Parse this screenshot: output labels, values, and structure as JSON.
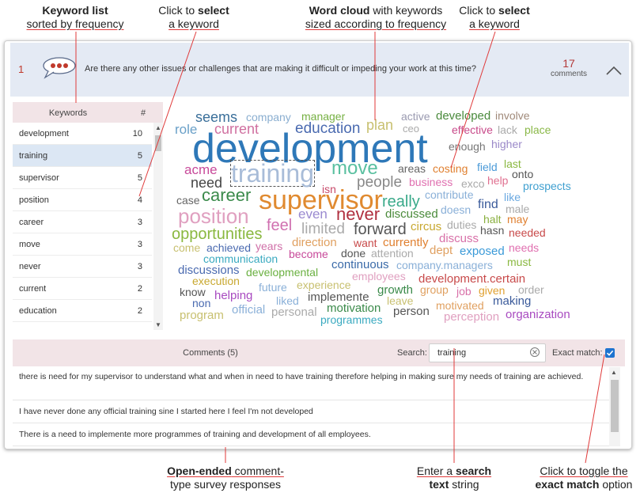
{
  "callouts": {
    "keyword_list": {
      "bold": "Keyword list",
      "rest": "sorted by frequency"
    },
    "click_select_1": {
      "pre": "Click to ",
      "bold": "select",
      "line2": "a keyword"
    },
    "word_cloud": {
      "bold": "Word cloud",
      "rest1": " with keywords",
      "line2": "sized according to frequency"
    },
    "click_select_2": {
      "pre": "Click to ",
      "bold": "select",
      "line2": "a keyword"
    },
    "open_ended": {
      "bold": "Open-ended",
      "rest1": " comment-",
      "line2": "type survey responses"
    },
    "search": {
      "pre": "Enter a ",
      "bold1": "search",
      "bold2": "text",
      "post": " string"
    },
    "toggle": {
      "line1": "Click to toggle the",
      "bold": "exact match",
      "post": " option"
    }
  },
  "question": {
    "number": "1",
    "text": "Are there any other issues or challenges that are making it difficult or impeding your work at this time?",
    "comment_count": "17",
    "comment_label": "comments",
    "icon": "speech-bubble-icon"
  },
  "keywords": {
    "header_label": "Keywords",
    "header_count": "#",
    "items": [
      {
        "word": "development",
        "count": "10"
      },
      {
        "word": "training",
        "count": "5"
      },
      {
        "word": "supervisor",
        "count": "5"
      },
      {
        "word": "position",
        "count": "4"
      },
      {
        "word": "career",
        "count": "3"
      },
      {
        "word": "move",
        "count": "3"
      },
      {
        "word": "never",
        "count": "3"
      },
      {
        "word": "current",
        "count": "2"
      },
      {
        "word": "education",
        "count": "2"
      }
    ]
  },
  "cloud": {
    "words": [
      {
        "t": "seems",
        "c": "#3a6f9a"
      },
      {
        "t": "company",
        "c": "#8aaed0"
      },
      {
        "t": "manager",
        "c": "#76b043"
      },
      {
        "t": "active",
        "c": "#9a9ab0"
      },
      {
        "t": "developed",
        "c": "#4a8a3c"
      },
      {
        "t": "involve",
        "c": "#a08a7a"
      },
      {
        "t": "role",
        "c": "#6aa0c8"
      },
      {
        "t": "current",
        "c": "#d070a0"
      },
      {
        "t": "education",
        "c": "#4a6ab0"
      },
      {
        "t": "plan",
        "c": "#c8c070"
      },
      {
        "t": "ceo",
        "c": "#aaaaaa"
      },
      {
        "t": "effective",
        "c": "#c84a8a"
      },
      {
        "t": "lack",
        "c": "#aaaaaa"
      },
      {
        "t": "place",
        "c": "#8ab848"
      },
      {
        "t": "development",
        "c": "#2e78b8"
      },
      {
        "t": "enough",
        "c": "#777777"
      },
      {
        "t": "higher",
        "c": "#9a88c8"
      },
      {
        "t": "acme",
        "c": "#c84a9a"
      },
      {
        "t": "training",
        "c": "#a8bcd8"
      },
      {
        "t": "move",
        "c": "#5ac0a0"
      },
      {
        "t": "areas",
        "c": "#666666"
      },
      {
        "t": "costing",
        "c": "#e08030"
      },
      {
        "t": "field",
        "c": "#4a9ad8"
      },
      {
        "t": "last",
        "c": "#8ab840"
      },
      {
        "t": "onto",
        "c": "#555555"
      },
      {
        "t": "need",
        "c": "#444444"
      },
      {
        "t": "people",
        "c": "#888888"
      },
      {
        "t": "business",
        "c": "#e070b0"
      },
      {
        "t": "exco",
        "c": "#aaaaaa"
      },
      {
        "t": "help",
        "c": "#e07090"
      },
      {
        "t": "prospects",
        "c": "#40a0d0"
      },
      {
        "t": "career",
        "c": "#3a8a4a"
      },
      {
        "t": "supervisor",
        "c": "#e08a30"
      },
      {
        "t": "isn",
        "c": "#c84a6a"
      },
      {
        "t": "contribute",
        "c": "#8ab0d8"
      },
      {
        "t": "like",
        "c": "#6aa8e0"
      },
      {
        "t": "case",
        "c": "#666666"
      },
      {
        "t": "really",
        "c": "#3aaa8a"
      },
      {
        "t": "find",
        "c": "#3a5a9a"
      },
      {
        "t": "male",
        "c": "#aaaaaa"
      },
      {
        "t": "position",
        "c": "#e0a0c0"
      },
      {
        "t": "even",
        "c": "#9a8ad0"
      },
      {
        "t": "never",
        "c": "#b03040"
      },
      {
        "t": "discussed",
        "c": "#4a8a3a"
      },
      {
        "t": "doesn",
        "c": "#8ab0d8"
      },
      {
        "t": "halt",
        "c": "#8ab040"
      },
      {
        "t": "may",
        "c": "#e08030"
      },
      {
        "t": "feel",
        "c": "#d070b0"
      },
      {
        "t": "limited",
        "c": "#aaaaaa"
      },
      {
        "t": "forward",
        "c": "#555555"
      },
      {
        "t": "circus",
        "c": "#c8a830"
      },
      {
        "t": "duties",
        "c": "#aaaaaa"
      },
      {
        "t": "hasn",
        "c": "#555555"
      },
      {
        "t": "needed",
        "c": "#c84a4a"
      },
      {
        "t": "opportunities",
        "c": "#8ab840"
      },
      {
        "t": "direction",
        "c": "#e0a060"
      },
      {
        "t": "want",
        "c": "#c84a4a"
      },
      {
        "t": "currently",
        "c": "#e08030"
      },
      {
        "t": "discuss",
        "c": "#d870a8"
      },
      {
        "t": "come",
        "c": "#c8c070"
      },
      {
        "t": "years",
        "c": "#d070a8"
      },
      {
        "t": "achieved",
        "c": "#4a6ab0"
      },
      {
        "t": "dept",
        "c": "#e0a060"
      },
      {
        "t": "exposed",
        "c": "#3a9ad8"
      },
      {
        "t": "needs",
        "c": "#e070b0"
      },
      {
        "t": "become",
        "c": "#c84a9a"
      },
      {
        "t": "done",
        "c": "#555555"
      },
      {
        "t": "attention",
        "c": "#aaaaaa"
      },
      {
        "t": "communication",
        "c": "#3aaac0"
      },
      {
        "t": "continuous",
        "c": "#3a6aa8"
      },
      {
        "t": "company.managers",
        "c": "#8ab0d8"
      },
      {
        "t": "must",
        "c": "#8ab840"
      },
      {
        "t": "discussions",
        "c": "#4a6ab0"
      },
      {
        "t": "developmental",
        "c": "#6ab040"
      },
      {
        "t": "employees",
        "c": "#e0a0c0"
      },
      {
        "t": "development.certain",
        "c": "#c84a4a"
      },
      {
        "t": "execution",
        "c": "#c8a830"
      },
      {
        "t": "future",
        "c": "#8ab0d8"
      },
      {
        "t": "experience",
        "c": "#c8c070"
      },
      {
        "t": "growth",
        "c": "#3a8a4a"
      },
      {
        "t": "group",
        "c": "#e0a060"
      },
      {
        "t": "job",
        "c": "#d870a8"
      },
      {
        "t": "order",
        "c": "#aaaaaa"
      },
      {
        "t": "know",
        "c": "#555555"
      },
      {
        "t": "helping",
        "c": "#a84ac0"
      },
      {
        "t": "implemente",
        "c": "#555555"
      },
      {
        "t": "leave",
        "c": "#c8c070"
      },
      {
        "t": "given",
        "c": "#e0a030"
      },
      {
        "t": "making",
        "c": "#3a5a9a"
      },
      {
        "t": "non",
        "c": "#4a6ab0"
      },
      {
        "t": "liked",
        "c": "#8ab0d8"
      },
      {
        "t": "motivated",
        "c": "#e0a060"
      },
      {
        "t": "official",
        "c": "#8ab0d8"
      },
      {
        "t": "personal",
        "c": "#aaaaaa"
      },
      {
        "t": "motivation",
        "c": "#3a8a4a"
      },
      {
        "t": "person",
        "c": "#555555"
      },
      {
        "t": "program",
        "c": "#c8c070"
      },
      {
        "t": "programmes",
        "c": "#3aaac0"
      },
      {
        "t": "perception",
        "c": "#e0a0c0"
      },
      {
        "t": "organization",
        "c": "#a84ac0"
      }
    ]
  },
  "comments": {
    "header": "Comments (5)",
    "search_label": "Search:",
    "search_value": "training",
    "exact_label": "Exact match:",
    "rows": [
      "there is need for my supervisor to understand what and when in need to have training therefore helping in making sure my needs of training are achieved.",
      "I have never done any official training sine I started here I feel I'm not developed",
      "There is a need to implemente more programmes of training and development of all employees."
    ]
  },
  "colors": {
    "accent": "#1e74d0",
    "callout_line": "#e03a3a",
    "header_bg": "#e4eaf4",
    "bar_bg": "#f2e4e7"
  }
}
